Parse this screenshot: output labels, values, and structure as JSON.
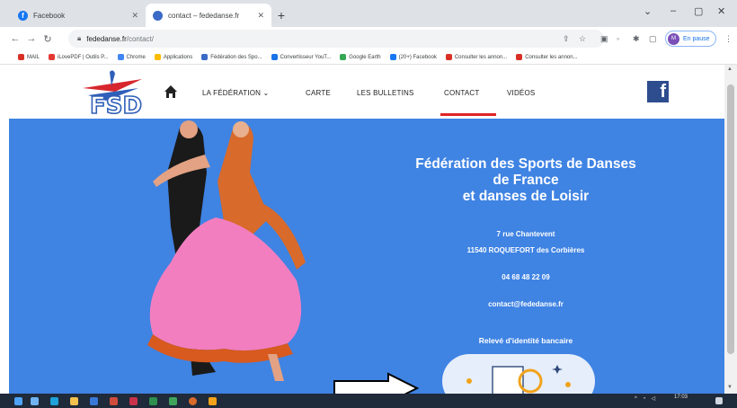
{
  "browser": {
    "tabs": [
      {
        "label": "Facebook",
        "icon": "facebook-icon",
        "active": false
      },
      {
        "label": "contact – fededanse.fr",
        "icon": "fsd-favicon",
        "active": true
      }
    ],
    "new_tab_label": "+",
    "window_controls": {
      "dropdown": "⌄",
      "minimize": "–",
      "maximize": "▢",
      "close": "✕"
    },
    "url": {
      "host": "fededanse.fr",
      "path": "/contact/"
    },
    "profile": {
      "initial": "M",
      "label": "En pause"
    },
    "bookmarks": [
      {
        "label": "MAIL",
        "color": "#d93025"
      },
      {
        "label": "iLovePDF | Outils P...",
        "color": "#e53935"
      },
      {
        "label": "Chrome",
        "color": "#4285f4"
      },
      {
        "label": "Applications",
        "color": "#fbbc04"
      },
      {
        "label": "Fédération des Spo...",
        "color": "#3b6ac7"
      },
      {
        "label": "Convertisseur YouT...",
        "color": "#1a73e8"
      },
      {
        "label": "Google Earth",
        "color": "#34a853"
      },
      {
        "label": "(20+) Facebook",
        "color": "#1877f2"
      },
      {
        "label": "Consulter les annon...",
        "color": "#d93025"
      },
      {
        "label": "Consulter les annon...",
        "color": "#d93025"
      }
    ]
  },
  "site": {
    "nav": [
      {
        "label": "LA FÉDÉRATION ⌄",
        "name": "nav-federation"
      },
      {
        "label": "CARTE",
        "name": "nav-carte"
      },
      {
        "label": "LES BULLETINS",
        "name": "nav-bulletins"
      },
      {
        "label": "CONTACT",
        "name": "nav-contact"
      },
      {
        "label": "VIDÉOS",
        "name": "nav-videos"
      }
    ],
    "facebook_letter": "f",
    "hero": {
      "title_lines": [
        "Fédération des Sports de Danses",
        "de France",
        "et danses de Loisir"
      ],
      "address_line1": "7 rue Chantevent",
      "address_line2": "11540 ROQUEFORT des Corbières",
      "phone": "04 68 48 22 09",
      "email": "contact@fededanse.fr",
      "rib_heading": "Relevé d'identité bancaire"
    },
    "accent_color": "#e02424",
    "hero_color": "#3f83e3"
  },
  "taskbar": {
    "clock_time": "17:03",
    "clock_date": ""
  }
}
